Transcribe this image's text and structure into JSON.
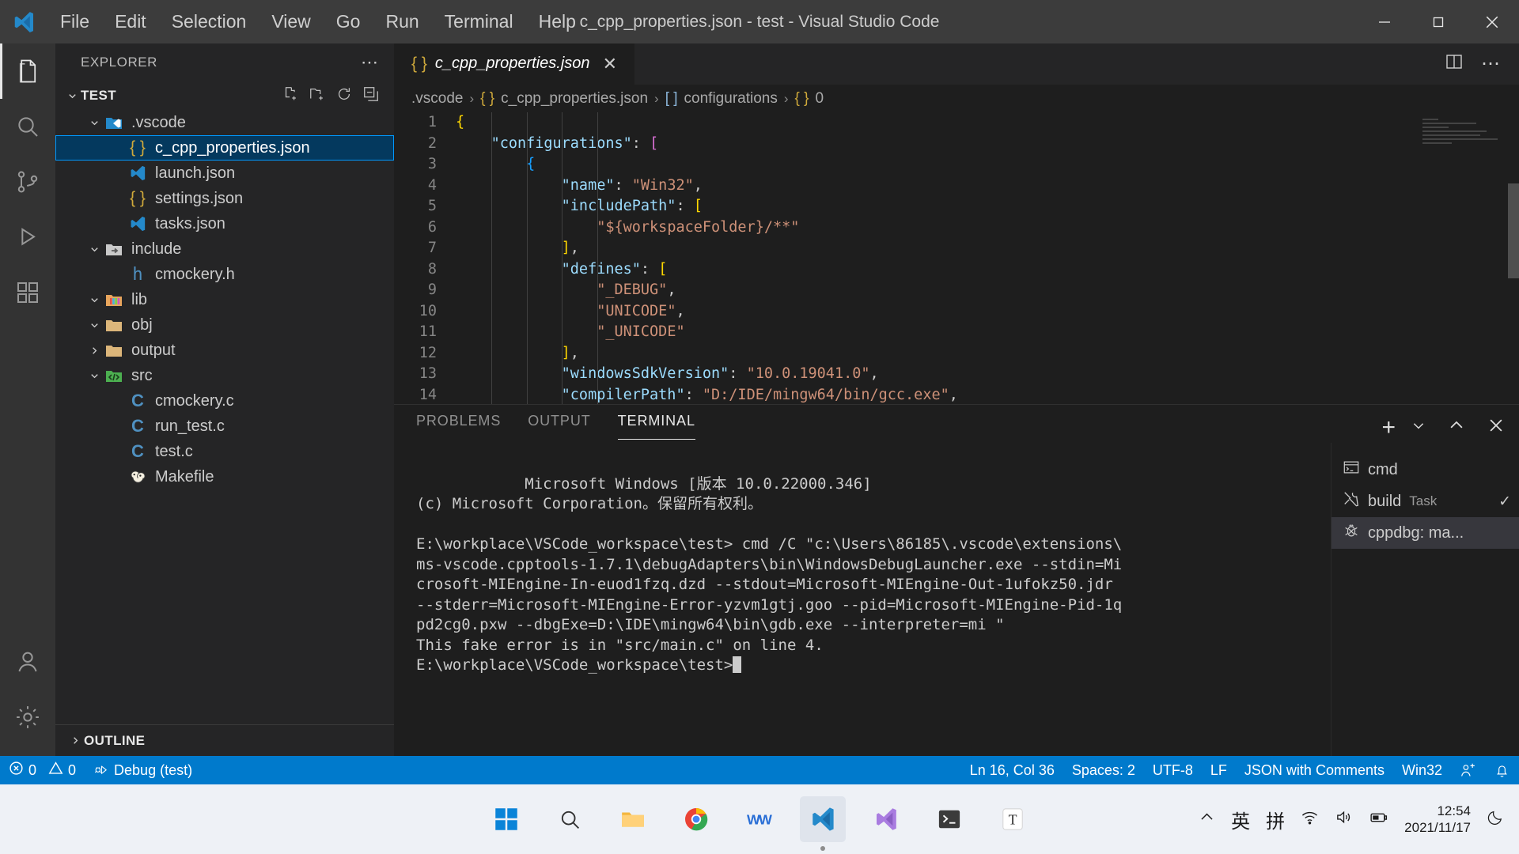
{
  "window": {
    "title": "c_cpp_properties.json - test - Visual Studio Code",
    "logo": "vscode-logo",
    "minimize": "─",
    "maximize": "❐",
    "close": "✕"
  },
  "menu": {
    "items": [
      "File",
      "Edit",
      "Selection",
      "View",
      "Go",
      "Run",
      "Terminal",
      "Help"
    ]
  },
  "activitybar": {
    "items": [
      {
        "name": "explorer",
        "icon": "files-icon",
        "active": true
      },
      {
        "name": "search",
        "icon": "search-icon",
        "active": false
      },
      {
        "name": "source-control",
        "icon": "source-control-icon",
        "active": false
      },
      {
        "name": "run-and-debug",
        "icon": "run-debug-icon",
        "active": false
      },
      {
        "name": "extensions",
        "icon": "extensions-icon",
        "active": false
      },
      {
        "name": "accounts",
        "icon": "account-icon",
        "active": false
      },
      {
        "name": "manage",
        "icon": "gear-icon",
        "active": false
      }
    ]
  },
  "sidebar": {
    "title": "EXPLORER",
    "more_actions": "⋯",
    "root": {
      "label": "TEST",
      "expanded": true,
      "actions": [
        "new-file-icon",
        "new-folder-icon",
        "refresh-icon",
        "collapse-all-icon"
      ]
    },
    "tree": [
      {
        "label": ".vscode",
        "indent": 1,
        "type": "folder",
        "icon": "vscode-folder-icon",
        "twisty": "chevron-down",
        "selected": false
      },
      {
        "label": "c_cpp_properties.json",
        "indent": 2,
        "type": "file",
        "icon": "json-braces-icon",
        "twisty": "none",
        "selected": true
      },
      {
        "label": "launch.json",
        "indent": 2,
        "type": "file",
        "icon": "vscode-file-icon",
        "twisty": "none",
        "selected": false
      },
      {
        "label": "settings.json",
        "indent": 2,
        "type": "file",
        "icon": "json-braces-icon",
        "twisty": "none",
        "selected": false
      },
      {
        "label": "tasks.json",
        "indent": 2,
        "type": "file",
        "icon": "vscode-file-icon",
        "twisty": "none",
        "selected": false
      },
      {
        "label": "include",
        "indent": 1,
        "type": "folder",
        "icon": "include-folder-icon",
        "twisty": "chevron-down",
        "selected": false
      },
      {
        "label": "cmockery.h",
        "indent": 2,
        "type": "file",
        "icon": "h-header-icon",
        "twisty": "none",
        "selected": false
      },
      {
        "label": "lib",
        "indent": 1,
        "type": "folder",
        "icon": "lib-folder-icon",
        "twisty": "chevron-down",
        "selected": false
      },
      {
        "label": "obj",
        "indent": 1,
        "type": "folder",
        "icon": "folder-icon",
        "twisty": "chevron-down",
        "selected": false
      },
      {
        "label": "output",
        "indent": 1,
        "type": "folder",
        "icon": "folder-icon",
        "twisty": "chevron-right",
        "selected": false
      },
      {
        "label": "src",
        "indent": 1,
        "type": "folder",
        "icon": "src-folder-icon",
        "twisty": "chevron-down",
        "selected": false
      },
      {
        "label": "cmockery.c",
        "indent": 2,
        "type": "file",
        "icon": "c-source-icon",
        "twisty": "none",
        "selected": false
      },
      {
        "label": "run_test.c",
        "indent": 2,
        "type": "file",
        "icon": "c-source-icon",
        "twisty": "none",
        "selected": false
      },
      {
        "label": "test.c",
        "indent": 2,
        "type": "file",
        "icon": "c-source-icon",
        "twisty": "none",
        "selected": false
      },
      {
        "label": "Makefile",
        "indent": 2,
        "type": "file",
        "icon": "makefile-icon",
        "twisty": "none",
        "selected": false
      }
    ],
    "outline": {
      "label": "OUTLINE",
      "twisty": "chevron-right"
    }
  },
  "editor": {
    "tab": {
      "label": "c_cpp_properties.json",
      "icon": "json-braces-icon",
      "close": "✕",
      "preview": true
    },
    "actions": [
      "split-editor-icon",
      "more-actions-icon"
    ],
    "breadcrumbs": [
      {
        "text": ".vscode",
        "icon": "none"
      },
      {
        "text": "c_cpp_properties.json",
        "icon": "json-braces-icon"
      },
      {
        "text": "configurations",
        "icon": "array-brackets-icon"
      },
      {
        "text": "0",
        "icon": "json-braces-icon"
      }
    ],
    "breadcrumb_separator": "›",
    "lines": [
      {
        "n": 1,
        "indent": 0,
        "tokens": [
          {
            "t": "{",
            "c": "b1"
          }
        ]
      },
      {
        "n": 2,
        "indent": 1,
        "tokens": [
          {
            "t": "\"configurations\"",
            "c": "j-key"
          },
          {
            "t": ": ",
            "c": "j-punc"
          },
          {
            "t": "[",
            "c": "b2"
          }
        ]
      },
      {
        "n": 3,
        "indent": 2,
        "tokens": [
          {
            "t": "{",
            "c": "b3"
          }
        ]
      },
      {
        "n": 4,
        "indent": 3,
        "tokens": [
          {
            "t": "\"name\"",
            "c": "j-key"
          },
          {
            "t": ": ",
            "c": "j-punc"
          },
          {
            "t": "\"Win32\"",
            "c": "j-str"
          },
          {
            "t": ",",
            "c": "j-punc"
          }
        ]
      },
      {
        "n": 5,
        "indent": 3,
        "tokens": [
          {
            "t": "\"includePath\"",
            "c": "j-key"
          },
          {
            "t": ": ",
            "c": "j-punc"
          },
          {
            "t": "[",
            "c": "b1"
          }
        ]
      },
      {
        "n": 6,
        "indent": 4,
        "tokens": [
          {
            "t": "\"${workspaceFolder}/**\"",
            "c": "j-str"
          }
        ]
      },
      {
        "n": 7,
        "indent": 3,
        "tokens": [
          {
            "t": "]",
            "c": "b1"
          },
          {
            "t": ",",
            "c": "j-punc"
          }
        ]
      },
      {
        "n": 8,
        "indent": 3,
        "tokens": [
          {
            "t": "\"defines\"",
            "c": "j-key"
          },
          {
            "t": ": ",
            "c": "j-punc"
          },
          {
            "t": "[",
            "c": "b1"
          }
        ]
      },
      {
        "n": 9,
        "indent": 4,
        "tokens": [
          {
            "t": "\"_DEBUG\"",
            "c": "j-str"
          },
          {
            "t": ",",
            "c": "j-punc"
          }
        ]
      },
      {
        "n": 10,
        "indent": 4,
        "tokens": [
          {
            "t": "\"UNICODE\"",
            "c": "j-str"
          },
          {
            "t": ",",
            "c": "j-punc"
          }
        ]
      },
      {
        "n": 11,
        "indent": 4,
        "tokens": [
          {
            "t": "\"_UNICODE\"",
            "c": "j-str"
          }
        ]
      },
      {
        "n": 12,
        "indent": 3,
        "tokens": [
          {
            "t": "]",
            "c": "b1"
          },
          {
            "t": ",",
            "c": "j-punc"
          }
        ]
      },
      {
        "n": 13,
        "indent": 3,
        "tokens": [
          {
            "t": "\"windowsSdkVersion\"",
            "c": "j-key"
          },
          {
            "t": ": ",
            "c": "j-punc"
          },
          {
            "t": "\"10.0.19041.0\"",
            "c": "j-str"
          },
          {
            "t": ",",
            "c": "j-punc"
          }
        ]
      },
      {
        "n": 14,
        "indent": 3,
        "tokens": [
          {
            "t": "\"compilerPath\"",
            "c": "j-key"
          },
          {
            "t": ": ",
            "c": "j-punc"
          },
          {
            "t": "\"D:/IDE/mingw64/bin/gcc.exe\"",
            "c": "j-str"
          },
          {
            "t": ",",
            "c": "j-punc"
          }
        ]
      }
    ]
  },
  "panel": {
    "tabs": [
      {
        "label": "PROBLEMS",
        "active": false
      },
      {
        "label": "OUTPUT",
        "active": false
      },
      {
        "label": "TERMINAL",
        "active": true
      }
    ],
    "actions": [
      {
        "name": "new-terminal-icon",
        "glyph": "+"
      },
      {
        "name": "chevron-down-icon",
        "glyph": "⌄"
      },
      {
        "name": "maximize-panel-icon",
        "glyph": "⌃"
      },
      {
        "name": "close-panel-icon",
        "glyph": "✕"
      }
    ],
    "terminal_output": "Microsoft Windows [版本 10.0.22000.346]\n(c) Microsoft Corporation。保留所有权利。\n\nE:\\workplace\\VSCode_workspace\\test> cmd /C \"c:\\Users\\86185\\.vscode\\extensions\\\nms-vscode.cpptools-1.7.1\\debugAdapters\\bin\\WindowsDebugLauncher.exe --stdin=Mi\ncrosoft-MIEngine-In-euod1fzq.dzd --stdout=Microsoft-MIEngine-Out-1ufokz50.jdr\n--stderr=Microsoft-MIEngine-Error-yzvm1gtj.goo --pid=Microsoft-MIEngine-Pid-1q\npd2cg0.pxw --dbgExe=D:\\IDE\\mingw64\\bin\\gdb.exe --interpreter=mi \"\nThis fake error is in \"src/main.c\" on line 4.\n",
    "terminal_prompt": "E:\\workplace\\VSCode_workspace\\test>",
    "terminal_tabs": [
      {
        "label": "cmd",
        "icon": "console-icon",
        "sub": "",
        "check": "",
        "active": false
      },
      {
        "label": "build",
        "icon": "tools-icon",
        "sub": "Task",
        "check": "✓",
        "active": false
      },
      {
        "label": "cppdbg: ma...",
        "icon": "bug-icon",
        "sub": "",
        "check": "",
        "active": true
      }
    ]
  },
  "statusbar": {
    "left": [
      {
        "name": "problems",
        "icon": "error-icon",
        "text": "0"
      },
      {
        "name": "warnings",
        "icon": "warning-icon",
        "text": "0"
      },
      {
        "name": "debug-target",
        "icon": "debug-icon",
        "text": "Debug (test)"
      }
    ],
    "right": [
      {
        "name": "cursor-position",
        "text": "Ln 16, Col 36"
      },
      {
        "name": "indentation",
        "text": "Spaces: 2"
      },
      {
        "name": "encoding",
        "text": "UTF-8"
      },
      {
        "name": "eol",
        "text": "LF"
      },
      {
        "name": "language-mode",
        "text": "JSON with Comments"
      },
      {
        "name": "config-target",
        "text": "Win32"
      },
      {
        "name": "live-share",
        "text": "",
        "icon": "live-share-icon"
      },
      {
        "name": "notifications",
        "text": "",
        "icon": "bell-icon"
      }
    ],
    "accent_color": "#007acc"
  },
  "taskbar": {
    "apps": [
      {
        "name": "start-button",
        "icon": "windows-logo-icon",
        "active": false
      },
      {
        "name": "search-taskbar",
        "icon": "search-icon",
        "active": false
      },
      {
        "name": "file-explorer",
        "icon": "folder-icon",
        "active": false
      },
      {
        "name": "chrome",
        "icon": "chrome-icon",
        "active": false
      },
      {
        "name": "wps",
        "icon": "wps-icon",
        "active": false
      },
      {
        "name": "vscode-stable",
        "icon": "vscode-icon",
        "active": true
      },
      {
        "name": "visual-studio",
        "icon": "visual-studio-icon",
        "active": false
      },
      {
        "name": "terminal-app",
        "icon": "terminal-icon",
        "active": false
      },
      {
        "name": "typora",
        "icon": "typora-icon",
        "active": false
      }
    ],
    "tray": {
      "chevron": "⌃",
      "ime_mode": "英",
      "ime_pinyin": "拼",
      "icons": [
        "wifi-icon",
        "volume-icon",
        "battery-icon"
      ],
      "time": "12:54",
      "date": "2021/11/17",
      "action_center": "notification-icon"
    }
  }
}
